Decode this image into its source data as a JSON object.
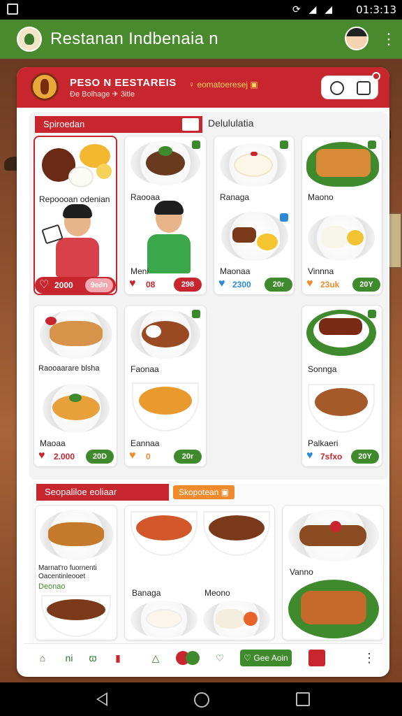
{
  "status_bar": {
    "time": "01:3:13",
    "icons": "⟳ ◢ ◢"
  },
  "app_bar": {
    "title": "Restanan Indbenaia n"
  },
  "header": {
    "title": "PESO N EESTAREIS",
    "subtitle": "Ðe Bolhage ✈ 3itle",
    "tag": "♀ eomatoeresej ▣"
  },
  "section_1": {
    "label": "Spiroedan",
    "alt_label": "Delululatia",
    "cards": [
      {
        "name": "Repoooan odenian",
        "heart": "♡",
        "price": "2000",
        "button": "9e∂n"
      },
      {
        "name": "Raooaa",
        "caption": "Meni",
        "heart": "♥",
        "price": "08",
        "button": "298"
      },
      {
        "name": "Ranaga",
        "caption": "Maonaa",
        "heart": "♥",
        "price": "2300",
        "button": "20r"
      },
      {
        "name": "Maono",
        "caption": "Vinnna",
        "heart": "♥",
        "price": "23uk",
        "button": "20Y"
      },
      {
        "name": "Raooaarare blsha",
        "caption": "Maoaa",
        "heart": "♥",
        "price": "2.000",
        "button": "20D"
      },
      {
        "name": "Faonaa",
        "caption": "Eannaa",
        "heart": "♥",
        "price": "0",
        "button": "20r"
      },
      {
        "name": "Sonnga",
        "caption": "Palkaeri",
        "heart": "♥",
        "price": "7sfxo",
        "button": "20Y"
      }
    ]
  },
  "section_2": {
    "label": "Seopaliloe eoliaar",
    "tag": "Skopotean ▣",
    "items": [
      {
        "name": "Marnat'ro fuornenti"
      },
      {
        "name": "Oacentinleooet"
      },
      {
        "name": "Deonao"
      },
      {
        "name": "Banaga"
      },
      {
        "name": "Meono"
      },
      {
        "name": "Vanno"
      }
    ]
  },
  "bottom_bar": {
    "cta": "♡ Gee Aoin",
    "icons": [
      "⌂",
      "ni",
      "ϖ",
      "▮",
      "△",
      "●",
      "♡"
    ]
  },
  "colors": {
    "brand_red": "#c8262e",
    "brand_green": "#3f8a2c",
    "app_bar": "#4a8a2e",
    "accent_orange": "#f08a2c"
  }
}
